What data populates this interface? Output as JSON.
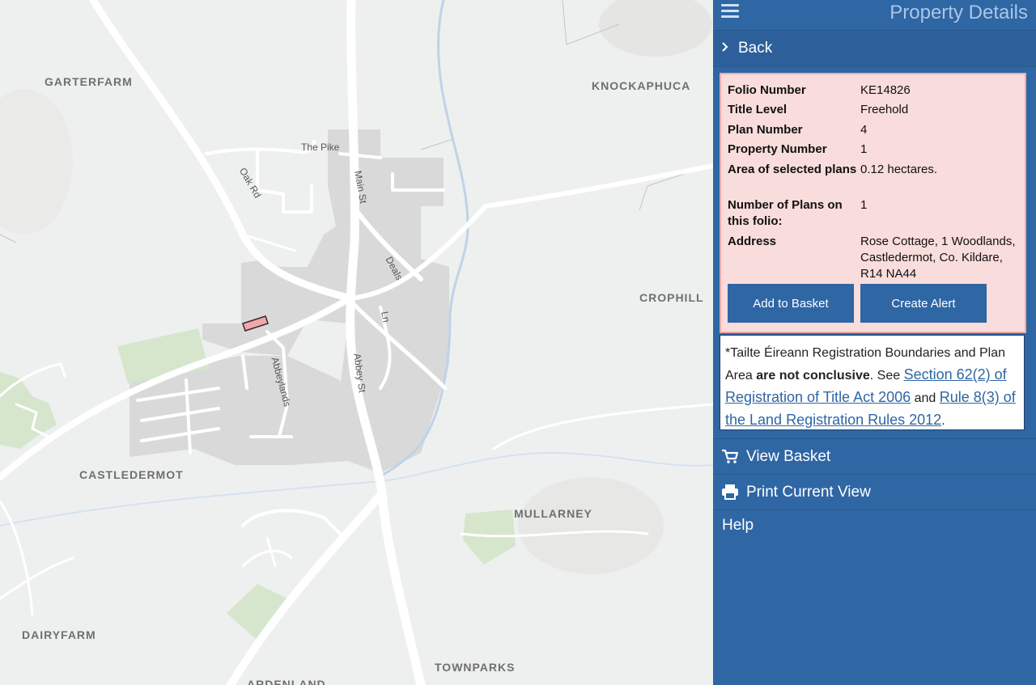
{
  "map": {
    "places": [
      "GARTERFARM",
      "KNOCKAPHUCA",
      "CROPHILL",
      "CASTLEDERMOT",
      "MULLARNEY",
      "DAIRYFARM",
      "TOWNPARKS",
      "ARDENLAND"
    ],
    "streets": [
      "The Pike",
      "Oak Rd",
      "Main St",
      "Deals",
      "Ln",
      "Abbeylands",
      "Abbey St"
    ]
  },
  "panel": {
    "title": "Property Details",
    "back_label": "Back",
    "details": {
      "folio_number_label": "Folio Number",
      "folio_number": "KE14826",
      "title_level_label": "Title Level",
      "title_level": "Freehold",
      "plan_number_label": "Plan Number",
      "plan_number": "4",
      "property_number_label": "Property Number",
      "property_number": "1",
      "area_label": "Area of selected plans",
      "area": "0.12 hectares.",
      "num_plans_label": "Number of Plans on this folio:",
      "num_plans": "1",
      "address_label": "Address",
      "address": "Rose Cottage, 1 Woodlands, Castledermot, Co. Kildare, R14 NA44"
    },
    "add_to_basket": "Add to Basket",
    "create_alert": "Create Alert",
    "notice": {
      "text1": "*Tailte Éireann Registration Boundaries and Plan Area ",
      "bold": "are not conclusive",
      "text2": ". See ",
      "link1": "Section 62(2) of Registration of Title Act 2006",
      "text3": " and ",
      "link2": "Rule 8(3) of the Land Registration Rules 2012",
      "text4": "."
    },
    "view_basket": "View Basket",
    "print_view": "Print Current View",
    "help": "Help"
  },
  "colors": {
    "panel_bg": "#2f66a4",
    "details_bg": "#f9dcdc",
    "details_border": "#efaaaa",
    "map_bg": "#eef0ef",
    "selected_parcel": "#f0a8aa"
  },
  "icons": [
    "hamburger-icon",
    "chevron-right-icon",
    "cart-icon",
    "printer-icon"
  ]
}
